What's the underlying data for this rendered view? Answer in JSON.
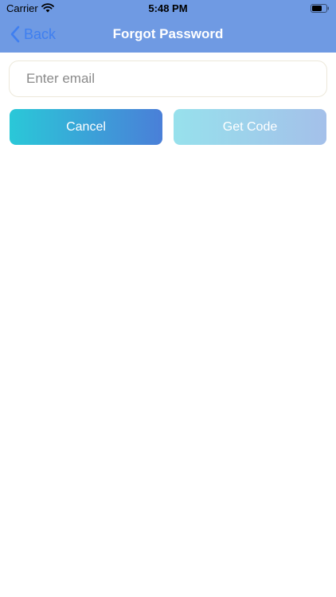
{
  "status_bar": {
    "carrier": "Carrier",
    "time": "5:48 PM",
    "wifi_icon": "wifi-icon",
    "battery_icon": "battery-icon"
  },
  "nav": {
    "back_label": "Back",
    "back_icon": "chevron-left-icon",
    "title": "Forgot Password"
  },
  "form": {
    "email_placeholder": "Enter email",
    "email_value": ""
  },
  "buttons": {
    "cancel_label": "Cancel",
    "get_code_label": "Get Code"
  },
  "colors": {
    "header": "#6f9ae3",
    "back_link": "#3f7ff0",
    "cancel_gradient_start": "#2ac8d8",
    "cancel_gradient_end": "#4a7fd8",
    "get_code_gradient_start": "#97e1ec",
    "get_code_gradient_end": "#a4c0ea"
  }
}
